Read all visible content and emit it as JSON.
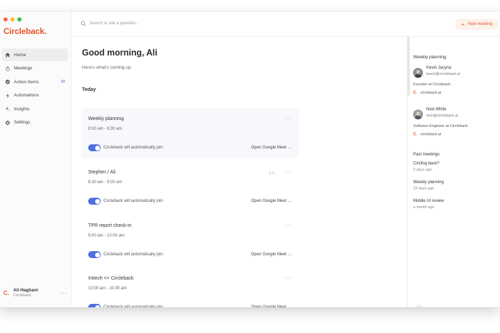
{
  "app": {
    "logo_text": "Circleback.",
    "accent": "#e8562a"
  },
  "sidebar": {
    "items": [
      {
        "label": "Home",
        "icon": "home-icon"
      },
      {
        "label": "Meetings",
        "icon": "flame-icon"
      },
      {
        "label": "Action Items",
        "icon": "check-circle-icon",
        "badge": "92"
      },
      {
        "label": "Automations",
        "icon": "bolt-icon"
      },
      {
        "label": "Insights",
        "icon": "sparkle-icon"
      },
      {
        "label": "Settings",
        "icon": "gear-icon"
      }
    ],
    "user": {
      "logo": "C.",
      "name": "Ali Haghani",
      "org": "Circleback",
      "more": "···"
    }
  },
  "topbar": {
    "search_placeholder": "Search or ask a question...",
    "new_meeting_label": "New meeting",
    "new_meeting_plus": "+"
  },
  "main": {
    "greeting": "Good morning, Ali",
    "subtext": "Here's what's coming up.",
    "section_label": "Today",
    "toggle_label": "Circleback will automatically join",
    "open_label": "Open Google Meet →",
    "more": "···",
    "meetings": [
      {
        "title": "Weekly planning",
        "time": "8:00 am - 8:30 am"
      },
      {
        "title": "Stephen / Ali",
        "time": "8:30 am - 9:00 am",
        "mini": "1:1"
      },
      {
        "title": "TPR report check-in",
        "time": "9:00 am - 10:00 am"
      },
      {
        "title": "Initech <> Circleback",
        "time": "10:00 am - 10:30 am"
      }
    ]
  },
  "right_panel": {
    "title": "Weekly planning",
    "attendees": [
      {
        "name": "Kevin Jacyna",
        "email": "kevin@circleback.ai",
        "role": "Founder at Circleback",
        "org": "circleback.ai"
      },
      {
        "name": "Nick White",
        "email": "nick@circleback.ai",
        "role": "Software Engineer at Circleback",
        "org": "circleback.ai"
      }
    ],
    "org_logo": "C.",
    "past_title": "Past meetings",
    "past_meetings": [
      {
        "name": "Circling back?",
        "when": "2 days ago"
      },
      {
        "name": "Weekly planning",
        "when": "23 days ago"
      },
      {
        "name": "Mobile UI review",
        "when": "a month ago"
      }
    ],
    "expand_glyph": "›"
  }
}
